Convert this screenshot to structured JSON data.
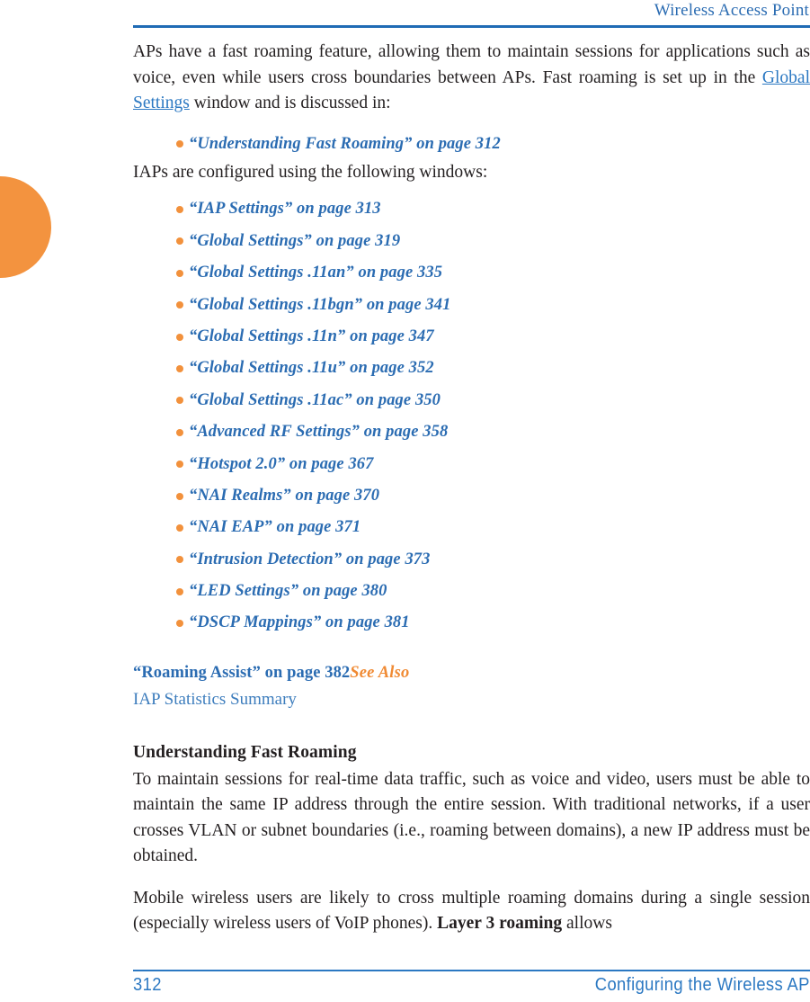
{
  "header": {
    "title": "Wireless Access Point"
  },
  "decor": {
    "thumb_tab_color": "#f3933f",
    "rule_color": "#1f6bb5"
  },
  "body": {
    "intro_para_before_link": "APs have a fast roaming feature, allowing them to maintain sessions for applications such as voice, even while users cross boundaries between APs. Fast roaming is set up in the ",
    "intro_link": "Global Settings",
    "intro_para_after_link": " window and is discussed in:",
    "first_list": [
      {
        "label": "“Understanding Fast Roaming” on page 312"
      }
    ],
    "iap_line": "IAPs are configured using the following windows:",
    "second_list": [
      {
        "label": "“IAP Settings” on page 313"
      },
      {
        "label": "“Global Settings” on page 319"
      },
      {
        "label": "“Global Settings .11an” on page 335"
      },
      {
        "label": "“Global Settings .11bgn” on page 341"
      },
      {
        "label": "“Global Settings .11n” on page 347"
      },
      {
        "label": "“Global Settings .11u” on page 352"
      },
      {
        "label": "“Global Settings .11ac” on page 350"
      },
      {
        "label": "“Advanced RF Settings” on page 358"
      },
      {
        "label": "“Hotspot 2.0” on page 367"
      },
      {
        "label": "“NAI Realms” on page 370"
      },
      {
        "label": "“NAI EAP” on page 371"
      },
      {
        "label": "“Intrusion Detection” on page 373"
      },
      {
        "label": "“LED Settings” on page 380"
      },
      {
        "label": "“DSCP Mappings” on page 381"
      }
    ],
    "roaming_assist_xref": "“Roaming Assist” on page 382",
    "see_also_label": "See Also",
    "iap_statistics_summary": "IAP Statistics Summary",
    "section_heading": "Understanding Fast Roaming",
    "para_maintain": "To maintain sessions for real-time data traffic, such as voice and video, users must be able to maintain the same IP address through the entire session. With traditional networks, if a user crosses VLAN or subnet boundaries (i.e., roaming between domains), a new IP address must be obtained.",
    "para_mobile_before_bold": "Mobile wireless users are likely to cross multiple roaming domains during a single session (especially wireless users of VoIP phones). ",
    "para_mobile_bold": "Layer 3 roaming",
    "para_mobile_after_bold": " allows"
  },
  "footer": {
    "page_number": "312",
    "chapter": "Configuring the Wireless AP"
  },
  "colors": {
    "link_blue": "#2b6cb2",
    "accent_orange": "#f2913c",
    "header_blue": "#1f6bb5",
    "text_black": "#231f20"
  }
}
